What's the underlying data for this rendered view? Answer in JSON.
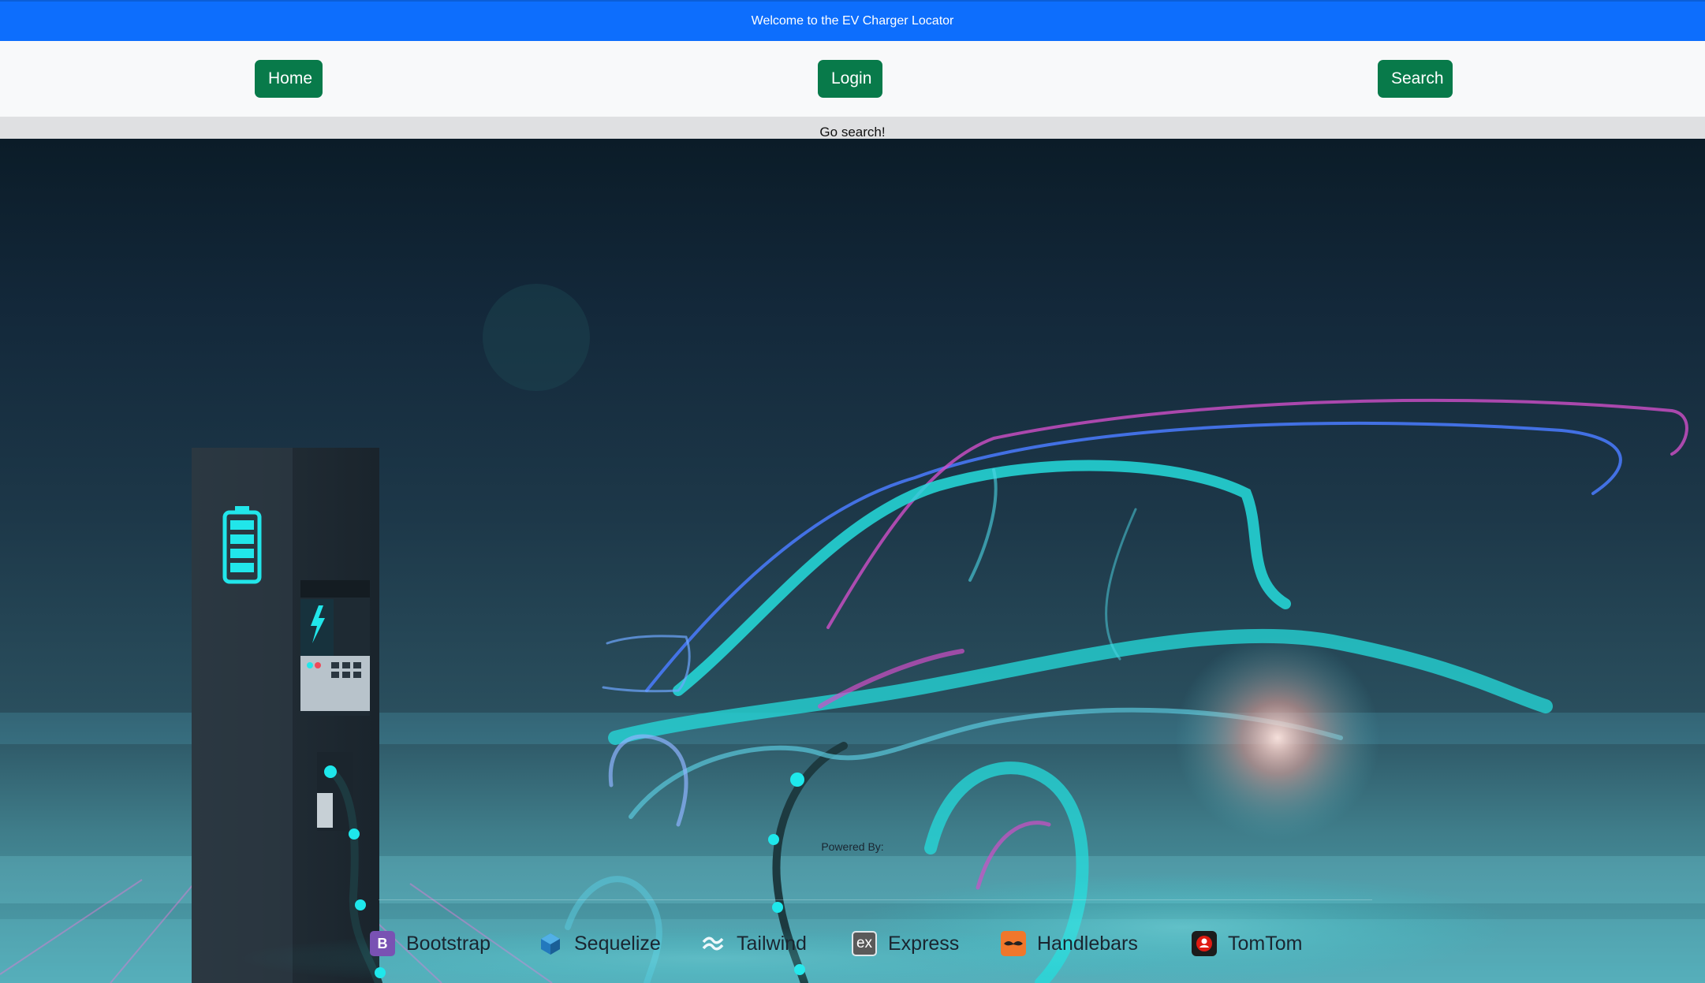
{
  "banner": {
    "text": "Welcome to the EV Charger Locator"
  },
  "nav": {
    "home_label": "Home",
    "login_label": "Login",
    "search_label": "Search",
    "button_color": "#087a4a"
  },
  "subbar": {
    "text": "Go search!"
  },
  "footer": {
    "powered_by": "Powered By:",
    "technologies": [
      {
        "label": "Bootstrap",
        "icon": "bootstrap-icon",
        "glyph": "B",
        "color": "#7952b3"
      },
      {
        "label": "Sequelize",
        "icon": "sequelize-icon",
        "glyph": "",
        "color": "#2379bd"
      },
      {
        "label": "Tailwind",
        "icon": "tailwind-icon",
        "glyph": "≈",
        "color": "#e8f4f8"
      },
      {
        "label": "Express",
        "icon": "express-icon",
        "glyph": "ex",
        "color": "#555555"
      },
      {
        "label": "Handlebars",
        "icon": "handlebars-icon",
        "glyph": "〰",
        "color": "#f0772b"
      },
      {
        "label": "TomTom",
        "icon": "tomtom-icon",
        "glyph": "●",
        "color": "#df1b12"
      }
    ]
  },
  "colors": {
    "banner": "#0d6efd",
    "navbar": "#f8f9fa",
    "subbar": "#dfe0e2",
    "glow_cyan": "#1ee3e3",
    "glow_pink": "#d04fc8",
    "glow_blue": "#4a7bff"
  }
}
